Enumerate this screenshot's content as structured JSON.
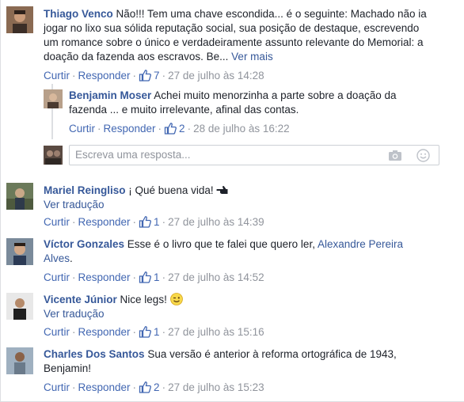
{
  "colors": {
    "name": "#365899",
    "action": "#4267b2",
    "meta": "#90949c",
    "text": "#1d2129"
  },
  "comments": [
    {
      "author": "Thiago Venco",
      "text_lines": [
        "Não!!! Tem uma chave escondida... é o seguinte: Machado não ia",
        "jogar no lixo sua sólida reputação social, sua posição de destaque, escrevendo",
        "um romance sobre o único e verdadeiramente assunto relevante do Memorial: a",
        "doação da fazenda aos escravos. Be..."
      ],
      "see_more": "Ver mais",
      "reply_label": "Curtir",
      "respond_label": "Responder",
      "likes": "7",
      "time": "27 de julho às 14:28"
    },
    {
      "author": "Benjamin Moser",
      "text_lines": [
        "Achei muito menorzinha a parte sobre a doação da",
        "fazenda ... e muito irrelevante, afinal das contas."
      ],
      "reply_label": "Curtir",
      "respond_label": "Responder",
      "likes": "2",
      "time": "28 de julho às 16:22"
    },
    {
      "author": "Mariel Reingliso",
      "text": "¡ Qué buena vida!",
      "emoji_icon": "pointing-hand-icon",
      "translate": "Ver tradução",
      "reply_label": "Curtir",
      "respond_label": "Responder",
      "likes": "1",
      "time": "27 de julho às 14:39"
    },
    {
      "author": "Víctor Gonzales",
      "text": "Esse é o livro que te falei que quero ler,",
      "mention": "Alexandre Pereira",
      "mention_cont": "Alves",
      "tail": ".",
      "reply_label": "Curtir",
      "respond_label": "Responder",
      "likes": "1",
      "time": "27 de julho às 14:52"
    },
    {
      "author": "Vicente Júnior",
      "text": "Nice legs!",
      "emoji_icon": "wink-emoji-icon",
      "translate": "Ver tradução",
      "reply_label": "Curtir",
      "respond_label": "Responder",
      "likes": "1",
      "time": "27 de julho às 15:16"
    },
    {
      "author": "Charles Dos Santos",
      "text_lines": [
        "Sua versão é anterior à reforma ortográfica de 1943,",
        "Benjamin!"
      ],
      "reply_label": "Curtir",
      "respond_label": "Responder",
      "likes": "2",
      "time": "27 de julho às 15:23"
    }
  ],
  "reply_input": {
    "placeholder": "Escreva uma resposta..."
  }
}
